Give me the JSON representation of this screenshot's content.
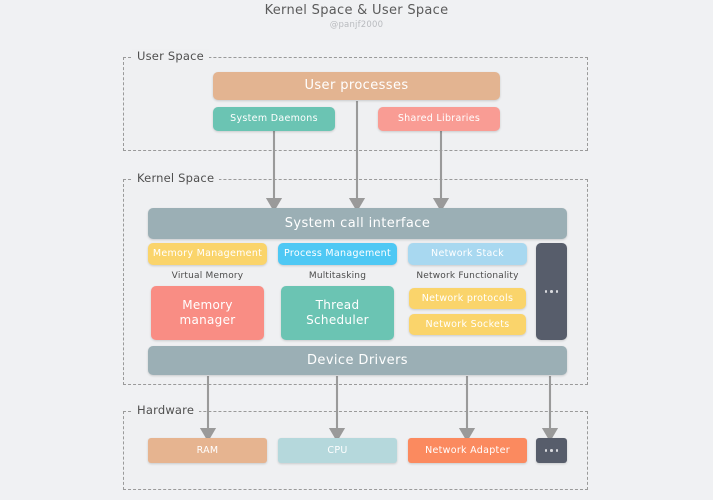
{
  "title": "Kernel Space & User Space",
  "subtitle": "@panjf2000",
  "colors": {
    "background": "#f0f1f3",
    "zone_border": "#9a9a9a",
    "arrow": "#9a9a9a",
    "user_processes": "#e3b491",
    "system_daemons": "#6bc4b3",
    "shared_libraries": "#f99c94",
    "system_call_interface": "#9bafb5",
    "memory_management": "#fad46b",
    "process_management": "#4ec8f4",
    "network_stack": "#a8d8f0",
    "memory_manager": "#f98d84",
    "thread_scheduler": "#6bc4b3",
    "network_protocols": "#fad46b",
    "network_sockets": "#fad46b",
    "device_drivers": "#9bafb5",
    "ram": "#e6b490",
    "cpu": "#b5d8dc",
    "network_adapter": "#fb8a5f",
    "ellipsis_box": "#575d6b"
  },
  "zones": {
    "user_space": {
      "label": "User Space"
    },
    "kernel_space": {
      "label": "Kernel Space"
    },
    "hardware": {
      "label": "Hardware"
    }
  },
  "user_space": {
    "user_processes": "User processes",
    "system_daemons": "System Daemons",
    "shared_libraries": "Shared Libraries"
  },
  "kernel_space": {
    "system_call_interface": "System call interface",
    "memory_management": "Memory Management",
    "process_management": "Process Management",
    "network_stack": "Network Stack",
    "more_subsystems": "...",
    "captions": {
      "virtual_memory": "Virtual Memory",
      "multitasking": "Multitasking",
      "network_functionality": "Network Functionality"
    },
    "memory_manager": "Memory\nmanager",
    "memory_manager_line1": "Memory",
    "memory_manager_line2": "manager",
    "thread_scheduler_line1": "Thread",
    "thread_scheduler_line2": "Scheduler",
    "network_protocols": "Network protocols",
    "network_sockets": "Network Sockets",
    "device_drivers": "Device Drivers"
  },
  "hardware": {
    "ram": "RAM",
    "cpu": "CPU",
    "network_adapter": "Network Adapter",
    "more_hardware": "..."
  }
}
